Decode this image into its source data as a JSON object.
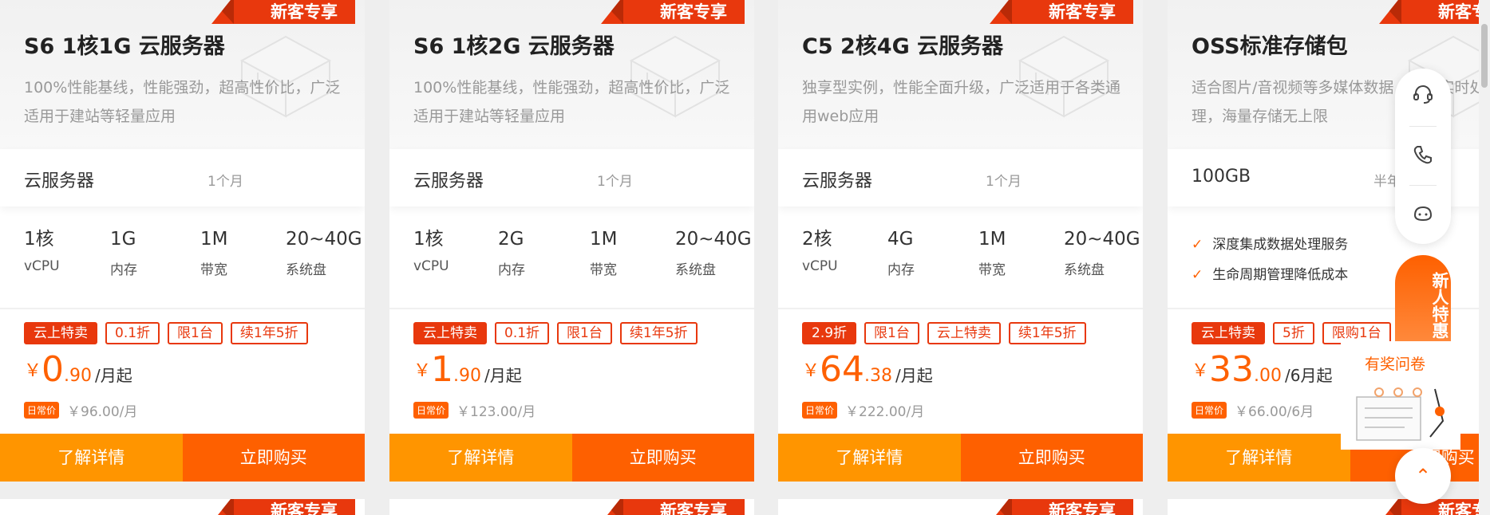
{
  "cards": [
    {
      "badge": "新客专享",
      "title": "S6 1核1G 云服务器",
      "desc": "100%性能基线，性能强劲，超高性价比，广泛适用于建站等轻量应用",
      "spec_name": "云服务器",
      "period": "1个月",
      "metrics": [
        {
          "value": "1核",
          "label": "vCPU"
        },
        {
          "value": "1G",
          "label": "内存"
        },
        {
          "value": "1M",
          "label": "带宽"
        },
        {
          "value": "20~40G",
          "label": "系统盘"
        }
      ],
      "tags": [
        "云上特卖",
        "0.1折",
        "限1台",
        "续1年5折"
      ],
      "price": {
        "currency": "￥",
        "int": "0",
        "dec": ".90",
        "unit": "/月起"
      },
      "orig_label": "日常价",
      "orig_price": "￥96.00/月",
      "btn_detail": "了解详情",
      "btn_buy": "立即购买"
    },
    {
      "badge": "新客专享",
      "title": "S6 1核2G 云服务器",
      "desc": "100%性能基线，性能强劲，超高性价比，广泛适用于建站等轻量应用",
      "spec_name": "云服务器",
      "period": "1个月",
      "metrics": [
        {
          "value": "1核",
          "label": "vCPU"
        },
        {
          "value": "2G",
          "label": "内存"
        },
        {
          "value": "1M",
          "label": "带宽"
        },
        {
          "value": "20~40G",
          "label": "系统盘"
        }
      ],
      "tags": [
        "云上特卖",
        "0.1折",
        "限1台",
        "续1年5折"
      ],
      "price": {
        "currency": "￥",
        "int": "1",
        "dec": ".90",
        "unit": "/月起"
      },
      "orig_label": "日常价",
      "orig_price": "￥123.00/月",
      "btn_detail": "了解详情",
      "btn_buy": "立即购买"
    },
    {
      "badge": "新客专享",
      "title": "C5 2核4G 云服务器",
      "desc": "独享型实例，性能全面升级，广泛适用于各类通用web应用",
      "spec_name": "云服务器",
      "period": "1个月",
      "metrics": [
        {
          "value": "2核",
          "label": "vCPU"
        },
        {
          "value": "4G",
          "label": "内存"
        },
        {
          "value": "1M",
          "label": "带宽"
        },
        {
          "value": "20~40G",
          "label": "系统盘"
        }
      ],
      "tags": [
        "2.9折",
        "限1台",
        "云上特卖",
        "续1年5折"
      ],
      "price": {
        "currency": "￥",
        "int": "64",
        "dec": ".38",
        "unit": "/月起"
      },
      "orig_label": "日常价",
      "orig_price": "￥222.00/月",
      "btn_detail": "了解详情",
      "btn_buy": "立即购买"
    },
    {
      "badge": "新客专享",
      "title": "OSS标准存储包",
      "desc": "适合图片/音视频等多媒体数据，数据实时处理，海量存储无上限",
      "spec_name": "100GB",
      "period": "半年",
      "checks": [
        "深度集成数据处理服务",
        "生命周期管理降低成本"
      ],
      "tags": [
        "云上特卖",
        "5折",
        "限购1台"
      ],
      "price": {
        "currency": "￥",
        "int": "33",
        "dec": ".00",
        "unit": "/6月起"
      },
      "orig_label": "日常价",
      "orig_price": "￥66.00/6月",
      "btn_detail": "了解详情",
      "btn_buy": "立即购买"
    }
  ],
  "next_badge": "新客专享",
  "float": {
    "new_user": "新人特惠",
    "survey": "有奖问卷",
    "top": "⌃"
  }
}
